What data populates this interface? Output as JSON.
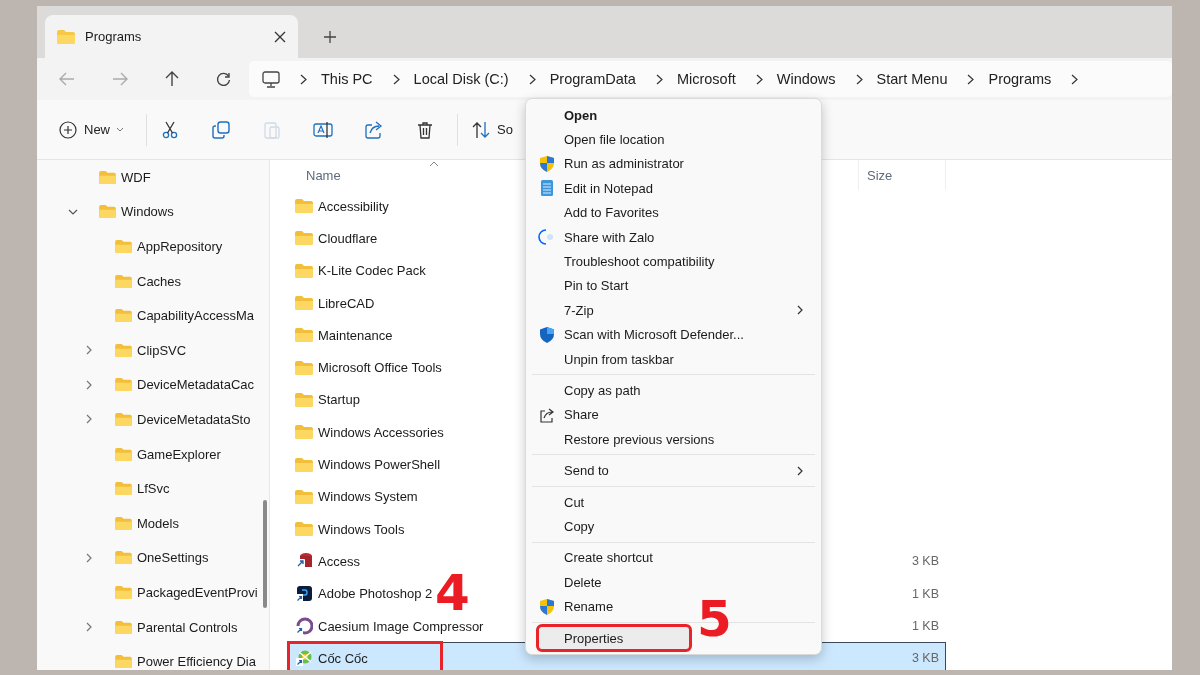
{
  "tabs": [
    {
      "title": "Programs",
      "selected": true
    }
  ],
  "address": [
    "This PC",
    "Local Disk (C:)",
    "ProgramData",
    "Microsoft",
    "Windows",
    "Start Menu",
    "Programs"
  ],
  "toolbar": [
    {
      "kind": "new",
      "label": "New",
      "disabled": false
    },
    {
      "kind": "cut",
      "disabled": false
    },
    {
      "kind": "copy",
      "disabled": false
    },
    {
      "kind": "paste",
      "disabled": true
    },
    {
      "kind": "rename",
      "disabled": false
    },
    {
      "kind": "share",
      "disabled": false
    },
    {
      "kind": "delete",
      "disabled": false
    },
    {
      "kind": "sort",
      "label": "So",
      "disabled": false
    }
  ],
  "tree": [
    {
      "label": "WDF",
      "kind": "leaf"
    },
    {
      "label": "Windows",
      "kind": "branch",
      "expanded": true,
      "children": [
        {
          "label": "AppRepository",
          "kind": "leaf"
        },
        {
          "label": "Caches",
          "kind": "leaf"
        },
        {
          "label": "CapabilityAccessMa",
          "kind": "leaf"
        },
        {
          "label": "ClipSVC",
          "kind": "branch",
          "expanded": false
        },
        {
          "label": "DeviceMetadataCac",
          "kind": "branch",
          "expanded": false
        },
        {
          "label": "DeviceMetadataSto",
          "kind": "branch",
          "expanded": false
        },
        {
          "label": "GameExplorer",
          "kind": "leaf"
        },
        {
          "label": "LfSvc",
          "kind": "leaf"
        },
        {
          "label": "Models",
          "kind": "leaf"
        },
        {
          "label": "OneSettings",
          "kind": "branch",
          "expanded": false
        },
        {
          "label": "PackagedEventProvi",
          "kind": "leaf"
        },
        {
          "label": "Parental Controls",
          "kind": "branch",
          "expanded": false
        },
        {
          "label": "Power Efficiency Dia",
          "kind": "leaf"
        }
      ]
    }
  ],
  "file_list": {
    "columns": [
      {
        "label": "Name",
        "sorted": true
      },
      {
        "label": "Size",
        "sorted": false
      }
    ],
    "rows": [
      {
        "name": "Accessibility",
        "kind": "folder",
        "selected": false,
        "marked": false
      },
      {
        "name": "Cloudflare",
        "kind": "folder",
        "selected": false,
        "marked": false
      },
      {
        "name": "K-Lite Codec Pack",
        "kind": "folder",
        "selected": false,
        "marked": false
      },
      {
        "name": "LibreCAD",
        "kind": "folder",
        "selected": false,
        "marked": false
      },
      {
        "name": "Maintenance",
        "kind": "folder",
        "selected": false,
        "marked": false
      },
      {
        "name": "Microsoft Office Tools",
        "kind": "folder",
        "selected": false,
        "marked": false
      },
      {
        "name": "Startup",
        "kind": "folder",
        "selected": false,
        "marked": false
      },
      {
        "name": "Windows Accessories",
        "kind": "folder",
        "selected": false,
        "marked": false
      },
      {
        "name": "Windows PowerShell",
        "kind": "folder",
        "selected": false,
        "marked": false
      },
      {
        "name": "Windows System",
        "kind": "folder",
        "selected": false,
        "marked": false
      },
      {
        "name": "Windows Tools",
        "kind": "folder",
        "selected": false,
        "marked": false
      },
      {
        "name": "Access",
        "kind": "access",
        "size": "3 KB",
        "selected": false,
        "marked": false
      },
      {
        "name": "Adobe Photoshop 2",
        "kind": "photoshop",
        "size": "1 KB",
        "selected": false,
        "marked": false
      },
      {
        "name": "Caesium Image Compressor",
        "kind": "caesium",
        "size": "1 KB",
        "selected": false,
        "marked": false
      },
      {
        "name": "Cốc Cốc",
        "kind": "coccoc",
        "size": "3 KB",
        "selected": true,
        "marked": true
      }
    ]
  },
  "context_menu": [
    [
      {
        "label": "Open",
        "kind": "plain",
        "default": true,
        "submenu": false,
        "hovered": false,
        "marked": false
      },
      {
        "label": "Open file location",
        "kind": "plain",
        "default": false,
        "submenu": false,
        "hovered": false,
        "marked": false
      },
      {
        "label": "Run as administrator",
        "kind": "shield",
        "default": false,
        "submenu": false,
        "hovered": false,
        "marked": false
      },
      {
        "label": "Edit in Notepad",
        "kind": "notepad",
        "default": false,
        "submenu": false,
        "hovered": false,
        "marked": false
      },
      {
        "label": "Add to Favorites",
        "kind": "plain",
        "default": false,
        "submenu": false,
        "hovered": false,
        "marked": false
      },
      {
        "label": "Share with Zalo",
        "kind": "zalo",
        "default": false,
        "submenu": false,
        "hovered": false,
        "marked": false
      },
      {
        "label": "Troubleshoot compatibility",
        "kind": "plain",
        "default": false,
        "submenu": false,
        "hovered": false,
        "marked": false
      },
      {
        "label": "Pin to Start",
        "kind": "plain",
        "default": false,
        "submenu": false,
        "hovered": false,
        "marked": false
      },
      {
        "label": "7-Zip",
        "kind": "plain",
        "default": false,
        "submenu": true,
        "hovered": false,
        "marked": false
      },
      {
        "label": "Scan with Microsoft Defender...",
        "kind": "defender",
        "default": false,
        "submenu": false,
        "hovered": false,
        "marked": false
      },
      {
        "label": "Unpin from taskbar",
        "kind": "plain",
        "default": false,
        "submenu": false,
        "hovered": false,
        "marked": false
      }
    ],
    [
      {
        "label": "Copy as path",
        "kind": "plain",
        "default": false,
        "submenu": false,
        "hovered": false,
        "marked": false
      },
      {
        "label": "Share",
        "kind": "share",
        "default": false,
        "submenu": false,
        "hovered": false,
        "marked": false
      },
      {
        "label": "Restore previous versions",
        "kind": "plain",
        "default": false,
        "submenu": false,
        "hovered": false,
        "marked": false
      }
    ],
    [
      {
        "label": "Send to",
        "kind": "plain",
        "default": false,
        "submenu": true,
        "hovered": false,
        "marked": false
      }
    ],
    [
      {
        "label": "Cut",
        "kind": "plain",
        "default": false,
        "submenu": false,
        "hovered": false,
        "marked": false
      },
      {
        "label": "Copy",
        "kind": "plain",
        "default": false,
        "submenu": false,
        "hovered": false,
        "marked": false
      }
    ],
    [
      {
        "label": "Create shortcut",
        "kind": "plain",
        "default": false,
        "submenu": false,
        "hovered": false,
        "marked": false
      },
      {
        "label": "Delete",
        "kind": "plain",
        "default": false,
        "submenu": false,
        "hovered": false,
        "marked": false
      },
      {
        "label": "Rename",
        "kind": "shield",
        "default": false,
        "submenu": false,
        "hovered": false,
        "marked": false
      }
    ],
    [
      {
        "label": "Properties",
        "kind": "plain",
        "default": false,
        "submenu": false,
        "hovered": true,
        "marked": true
      }
    ]
  ],
  "annotations": [
    {
      "label": "4"
    },
    {
      "label": "5"
    }
  ]
}
